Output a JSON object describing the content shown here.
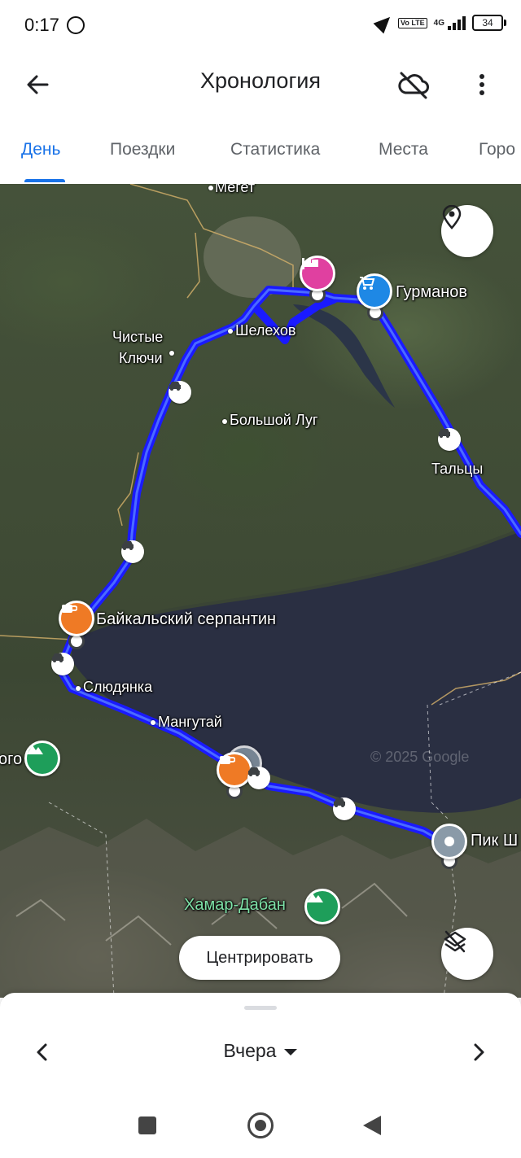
{
  "status_bar": {
    "time": "0:17",
    "volte": "Vo LTE",
    "network": "4G",
    "battery": "34"
  },
  "app_bar": {
    "title": "Хронология"
  },
  "tabs": [
    {
      "label": "День",
      "active": true
    },
    {
      "label": "Поездки",
      "active": false
    },
    {
      "label": "Статистика",
      "active": false
    },
    {
      "label": "Места",
      "active": false
    },
    {
      "label": "Горо",
      "active": false
    }
  ],
  "map": {
    "route_color": "#1a1aff",
    "labels": {
      "meget": "Мегет",
      "chistye": "Чистые",
      "klyuchi": "Ключи",
      "shelekhov": "Шелехов",
      "bolshoy_lug": "Большой Луг",
      "gurmanov": "Гурманов",
      "taltsy": "Тальцы",
      "baikal_serpantin": "Байкальский серпантин",
      "slyudyanka": "Слюдянка",
      "mangutay": "Мангутай",
      "pik": "Пик Ш",
      "khamar_daban": "Хамар-Дабан",
      "left_cut": "ого",
      "watermark": "© 2025 Google"
    },
    "pins": {
      "hotel": {
        "color": "#e040a0",
        "icon": "bed-icon"
      },
      "shop": {
        "color": "#1e88e5",
        "icon": "cart-icon"
      },
      "cafe1": {
        "color": "#ef7a25",
        "icon": "coffee-icon"
      },
      "cafe2": {
        "color": "#ef7a25",
        "icon": "coffee-icon"
      },
      "peak": {
        "color": "#8a9aa8",
        "icon": "place-icon"
      },
      "mountain1": {
        "color": "#1e9e5a",
        "icon": "mountain-icon"
      },
      "mountain2": {
        "color": "#1e9e5a",
        "icon": "mountain-icon"
      }
    },
    "center_button": "Центрировать"
  },
  "bottom_sheet": {
    "date": "Вчера"
  }
}
